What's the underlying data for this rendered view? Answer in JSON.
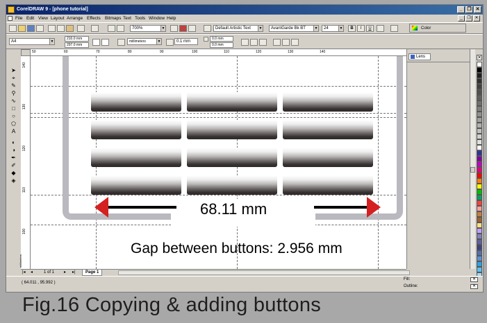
{
  "window": {
    "title": "CorelDRAW 9 - [phone tutorial]",
    "controls": [
      "_",
      "❐",
      "✕"
    ]
  },
  "menubar": {
    "items": [
      "File",
      "Edit",
      "View",
      "Layout",
      "Arrange",
      "Effects",
      "Bitmaps",
      "Text",
      "Tools",
      "Window",
      "Help"
    ],
    "mdi_controls": [
      "_",
      "❐",
      "✕"
    ]
  },
  "standard_toolbar": {
    "zoom_value": "700%",
    "text_style": "Default Artistic Text",
    "font_name": "AvantGarde Bk BT",
    "font_size": "24",
    "bold": "B",
    "italic": "I",
    "underline": "U",
    "color_docker_label": "Color"
  },
  "property_bar": {
    "page_size": "A4",
    "page_width": "210.0 mm",
    "page_height": "297.0 mm",
    "units": "millimeters",
    "nudge": "0.1 mm",
    "duplicate_x": "0.0 mm",
    "duplicate_y": "0.0 mm"
  },
  "rulers": {
    "horizontal_ticks": [
      "50",
      "60",
      "70",
      "80",
      "90",
      "100",
      "110",
      "120",
      "130",
      "140"
    ],
    "vertical_ticks": [
      "140",
      "130",
      "120",
      "110",
      "100"
    ],
    "units_label": "millimeters"
  },
  "drawing": {
    "dimension_text": "68.11 mm",
    "gap_text": "Gap between buttons: 2.956 mm",
    "key_rows": 4,
    "key_columns": 3,
    "arrow_color": "#d42020"
  },
  "dockers": {
    "lens_tab": "Lens"
  },
  "palette": {
    "colors": [
      "#ffffff",
      "#000000",
      "#202020",
      "#303030",
      "#404040",
      "#505050",
      "#606060",
      "#707070",
      "#808080",
      "#909090",
      "#a0a0a0",
      "#b0b0b0",
      "#c0c0c0",
      "#d0d0d0",
      "#e0e0e0",
      "#ffffff",
      "#3030a0",
      "#8000a0",
      "#c000c0",
      "#e00080",
      "#ff0000",
      "#ff8000",
      "#ffff00",
      "#00c000",
      "#00a060",
      "#ff4040",
      "#ffa0a0",
      "#c08040",
      "#a06030",
      "#ffe080",
      "#c0a0ff",
      "#8080c0",
      "#6060a0",
      "#404080",
      "#5070b0",
      "#6090d0",
      "#30a0e0",
      "#60c0f0",
      "#a0d8f8"
    ]
  },
  "pagebar": {
    "page_counter": "1 of 1",
    "page_tab": "Page 1"
  },
  "statusbar": {
    "coordinates": "( 64.011 , 95.992 )",
    "fill_label": "Fill:",
    "outline_label": "Outline:"
  },
  "caption": "Fig.16  Copying & adding buttons"
}
